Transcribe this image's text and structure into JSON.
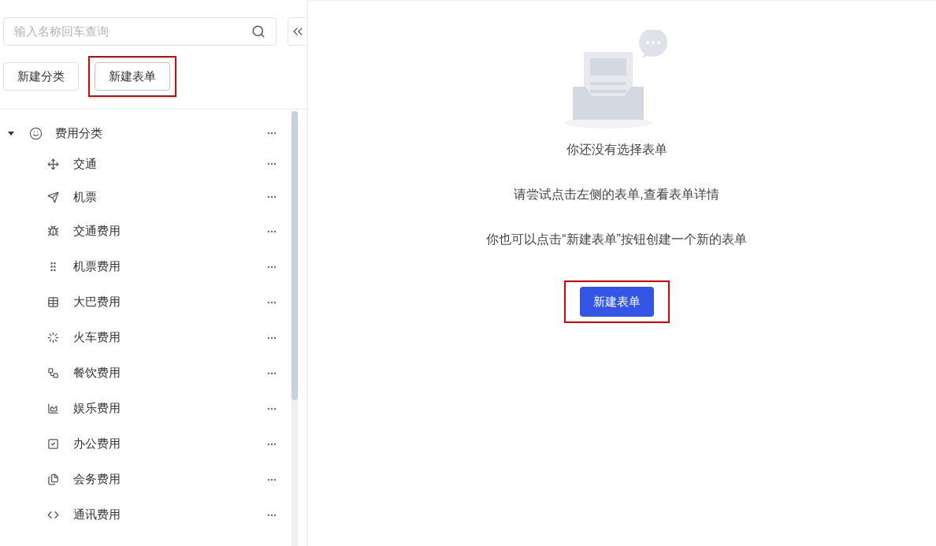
{
  "sidebar": {
    "search": {
      "placeholder": "输入名称回车查询"
    },
    "buttons": [
      {
        "label": "新建分类",
        "highlighted": false
      },
      {
        "label": "新建表单",
        "highlighted": true
      }
    ],
    "tree": [
      {
        "label": "费用分类",
        "expanded": true,
        "children": [
          {
            "label": "交通"
          },
          {
            "label": "机票"
          },
          {
            "label": "交通费用"
          },
          {
            "label": "机票费用"
          },
          {
            "label": "大巴费用"
          },
          {
            "label": "火车费用"
          },
          {
            "label": "餐饮费用"
          },
          {
            "label": "娱乐费用"
          },
          {
            "label": "办公费用"
          },
          {
            "label": "会务费用"
          },
          {
            "label": "通讯费用"
          }
        ]
      }
    ]
  },
  "empty_state": {
    "title": "你还没有选择表单",
    "lines": [
      "请尝试点击左侧的表单,查看表单详情",
      "你也可以点击“新建表单”按钮创建一个新的表单"
    ],
    "button": {
      "label": "新建表单",
      "highlighted": true
    }
  }
}
